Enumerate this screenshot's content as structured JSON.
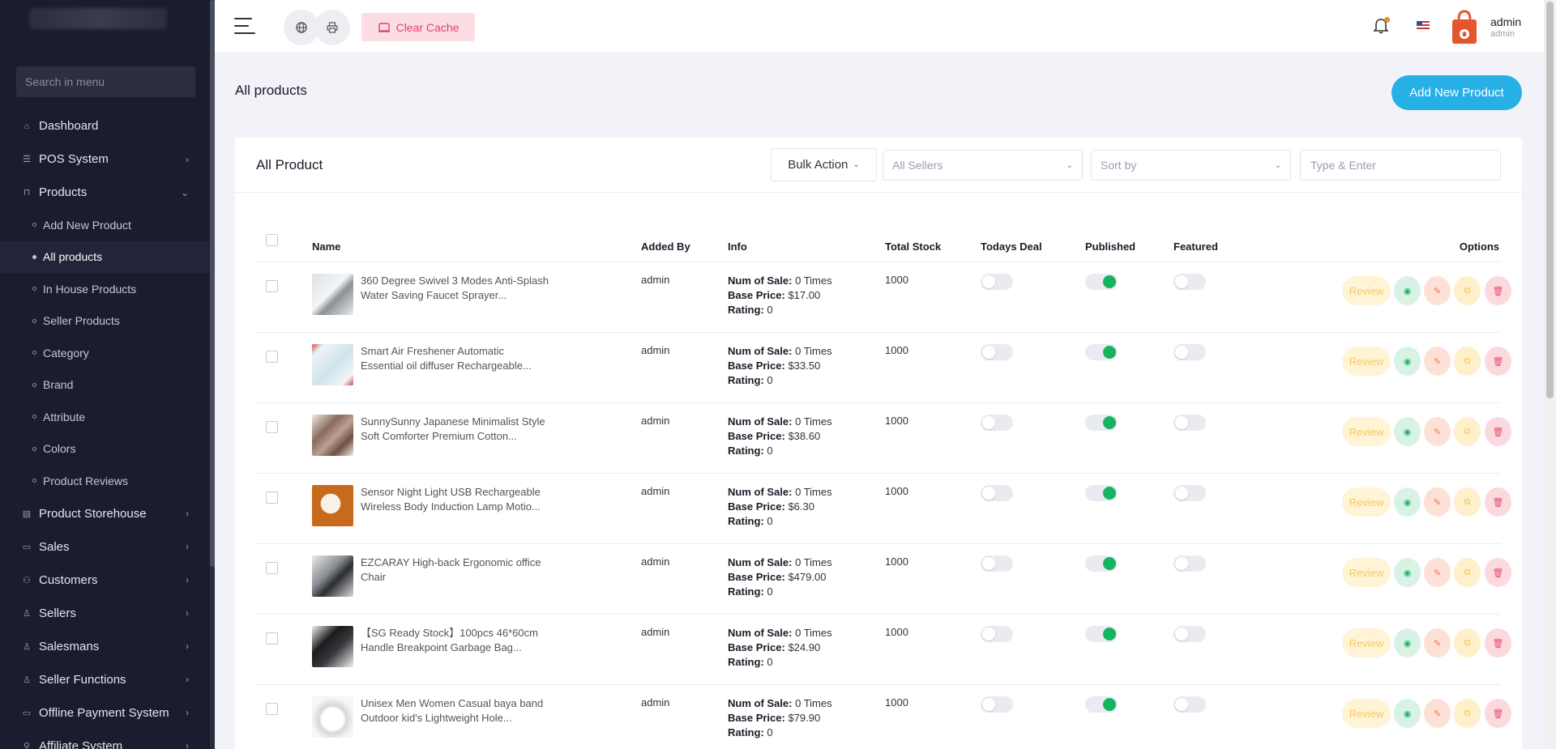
{
  "sidebar": {
    "search_placeholder": "Search in menu",
    "items": [
      {
        "label": "Dashboard",
        "icon": "home-icon",
        "arrow": ""
      },
      {
        "label": "POS System",
        "icon": "list-icon",
        "arrow": "›"
      },
      {
        "label": "Products",
        "icon": "cart-icon",
        "arrow": "⌄"
      }
    ],
    "sub_items": [
      {
        "label": "Add New Product"
      },
      {
        "label": "All products"
      },
      {
        "label": "In House Products"
      },
      {
        "label": "Seller Products"
      },
      {
        "label": "Category"
      },
      {
        "label": "Brand"
      },
      {
        "label": "Attribute"
      },
      {
        "label": "Colors"
      },
      {
        "label": "Product Reviews"
      }
    ],
    "items_after": [
      {
        "label": "Product Storehouse",
        "icon": "storehouse-icon",
        "arrow": "›"
      },
      {
        "label": "Sales",
        "icon": "sales-icon",
        "arrow": "›"
      },
      {
        "label": "Customers",
        "icon": "customers-icon",
        "arrow": "›"
      },
      {
        "label": "Sellers",
        "icon": "user-icon",
        "arrow": "›"
      },
      {
        "label": "Salesmans",
        "icon": "user-icon",
        "arrow": "›"
      },
      {
        "label": "Seller Functions",
        "icon": "user-icon",
        "arrow": "›"
      },
      {
        "label": "Offline Payment System",
        "icon": "payment-icon",
        "arrow": "›"
      },
      {
        "label": "Affiliate System",
        "icon": "link-icon",
        "arrow": "›"
      }
    ]
  },
  "topbar": {
    "clear_cache": "Clear Cache",
    "user_name": "admin",
    "user_role": "admin"
  },
  "page": {
    "title": "All products",
    "add_button": "Add New Product"
  },
  "card": {
    "title": "All Product",
    "bulk_action": "Bulk Action",
    "sellers_select": "All Sellers",
    "sort_select": "Sort by",
    "search_placeholder": "Type & Enter"
  },
  "table": {
    "headers": {
      "name": "Name",
      "added_by": "Added By",
      "info": "Info",
      "total_stock": "Total Stock",
      "todays_deal": "Todays Deal",
      "published": "Published",
      "featured": "Featured",
      "options": "Options"
    },
    "info_labels": {
      "sales": "Num of Sale:",
      "price": "Base Price:",
      "rating": "Rating:"
    },
    "review_label": "Review",
    "rows": [
      {
        "name": "360 Degree Swivel 3 Modes Anti-Splash Water Saving Faucet Sprayer...",
        "added_by": "admin",
        "sales": "0 Times",
        "price": "$17.00",
        "rating": "0",
        "stock": "1000",
        "todays_deal": false,
        "published": true,
        "featured": false
      },
      {
        "name": "Smart Air Freshener Automatic Essential oil diffuser Rechargeable...",
        "added_by": "admin",
        "sales": "0 Times",
        "price": "$33.50",
        "rating": "0",
        "stock": "1000",
        "todays_deal": false,
        "published": true,
        "featured": false
      },
      {
        "name": "SunnySunny Japanese Minimalist Style Soft Comforter Premium Cotton...",
        "added_by": "admin",
        "sales": "0 Times",
        "price": "$38.60",
        "rating": "0",
        "stock": "1000",
        "todays_deal": false,
        "published": true,
        "featured": false
      },
      {
        "name": "Sensor Night Light USB Rechargeable Wireless Body Induction Lamp Motio...",
        "added_by": "admin",
        "sales": "0 Times",
        "price": "$6.30",
        "rating": "0",
        "stock": "1000",
        "todays_deal": false,
        "published": true,
        "featured": false
      },
      {
        "name": "EZCARAY High-back Ergonomic office Chair",
        "added_by": "admin",
        "sales": "0 Times",
        "price": "$479.00",
        "rating": "0",
        "stock": "1000",
        "todays_deal": false,
        "published": true,
        "featured": false
      },
      {
        "name": "【SG Ready Stock】100pcs 46*60cm Handle Breakpoint Garbage Bag...",
        "added_by": "admin",
        "sales": "0 Times",
        "price": "$24.90",
        "rating": "0",
        "stock": "1000",
        "todays_deal": false,
        "published": true,
        "featured": false
      },
      {
        "name": "Unisex Men Women Casual baya band Outdoor kid's Lightweight Hole...",
        "added_by": "admin",
        "sales": "0 Times",
        "price": "$79.90",
        "rating": "0",
        "stock": "1000",
        "todays_deal": false,
        "published": true,
        "featured": false
      }
    ]
  },
  "colors": {
    "sidebar_bg": "#1a1d2e",
    "accent": "#26b0e6",
    "published_on": "#16b461",
    "clear_cache_text": "#e0446c"
  }
}
